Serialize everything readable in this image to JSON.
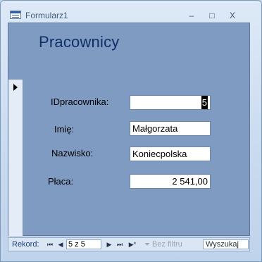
{
  "window": {
    "title": "Formularz1",
    "controls": {
      "minimize": "–",
      "maximize": "□",
      "close": "X"
    }
  },
  "form": {
    "title": "Pracownicy",
    "fields": [
      {
        "label": "IDpracownika:",
        "value": "5"
      },
      {
        "label": "Imię:",
        "value": "Małgorzata"
      },
      {
        "label": "Nazwisko:",
        "value": "Koniecpolska"
      },
      {
        "label": "Płaca:",
        "value": "2 541,00"
      }
    ]
  },
  "navigation": {
    "label": "Rekord:",
    "first": "⏮",
    "prev": "◀",
    "next": "▶",
    "last": "⏭",
    "new": "▶*",
    "position": "5 z 5",
    "filter": "Bez filtru",
    "search": "Wyszukaj"
  },
  "colors": {
    "form_background": "#7f9bc1",
    "title_color": "#0f2f66",
    "nav_label": "#1c3f7a"
  }
}
